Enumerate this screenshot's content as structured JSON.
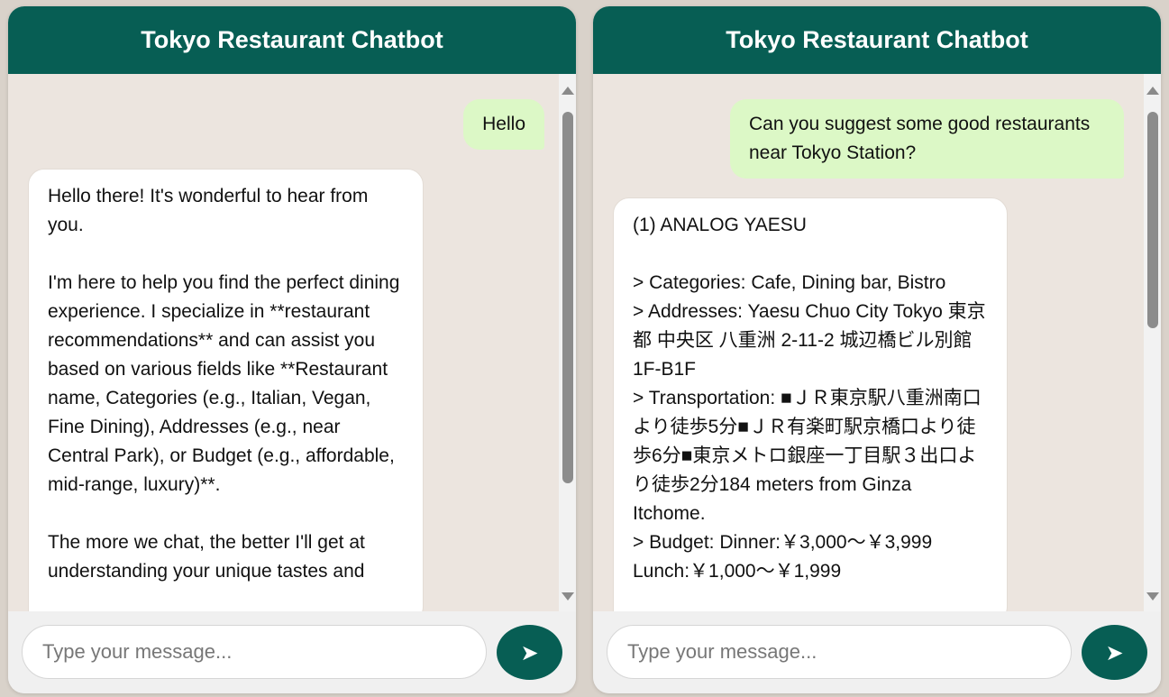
{
  "left_chat": {
    "title": "Tokyo Restaurant Chatbot",
    "messages": {
      "user": "Hello",
      "bot": "Hello there! It's wonderful to hear from you.\n\nI'm here to help you find the perfect dining experience. I specialize in **restaurant recommendations** and can assist you based on various fields like **Restaurant name, Categories (e.g., Italian, Vegan, Fine Dining), Addresses (e.g., near Central Park), or Budget (e.g., affordable, mid-range, luxury)**.\n\nThe more we chat, the better I'll get at understanding your unique tastes and"
    },
    "input": {
      "placeholder": "Type your message..."
    },
    "send_icon": "➤"
  },
  "right_chat": {
    "title": "Tokyo Restaurant Chatbot",
    "messages": {
      "user": "Can you suggest some good restaurants near Tokyo Station?",
      "bot": "(1) ANALOG YAESU\n\n> Categories: Cafe, Dining bar, Bistro\n> Addresses: Yaesu Chuo City Tokyo 東京都 中央区 八重洲 2-11-2 城辺橋ビル別館 1F-B1F\n> Transportation: ■ＪＲ東京駅八重洲南口より徒歩5分■ＪＲ有楽町駅京橋口より徒歩6分■東京メトロ銀座一丁目駅３出口より徒歩2分184 meters from Ginza Itchome.\n> Budget: Dinner:￥3,000～￥3,999 Lunch:￥1,000～￥1,999"
    },
    "input": {
      "placeholder": "Type your message..."
    },
    "send_icon": "➤"
  },
  "colors": {
    "header": "#075e54",
    "user_bubble": "#dcf8c6",
    "bot_bubble": "#ffffff",
    "chat_background": "#ece5df"
  },
  "icons": {
    "send": "send-icon",
    "scroll_up": "scroll-up-arrow-icon",
    "scroll_down": "scroll-down-arrow-icon"
  }
}
